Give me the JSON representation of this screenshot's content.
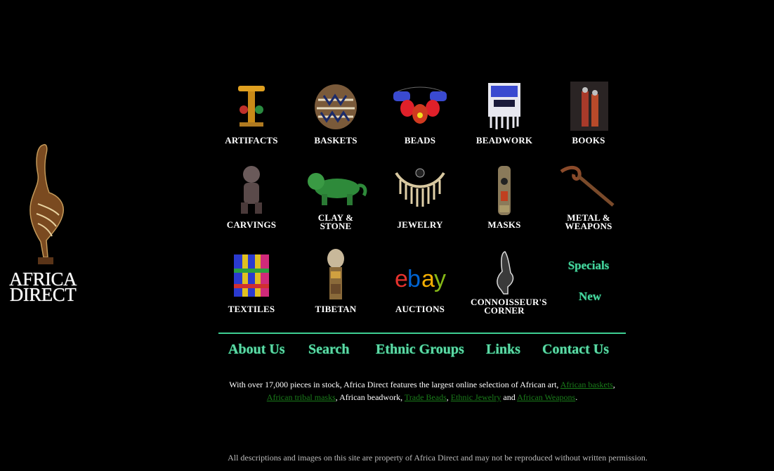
{
  "logo": {
    "line1": "AFRICA",
    "line2": "DIRECT"
  },
  "categories": [
    {
      "label1": "ARTIFACTS",
      "label2": ""
    },
    {
      "label1": "BASKETS",
      "label2": ""
    },
    {
      "label1": "BEADS",
      "label2": ""
    },
    {
      "label1": "BEADWORK",
      "label2": ""
    },
    {
      "label1": "BOOKS",
      "label2": ""
    },
    {
      "label1": "CARVINGS",
      "label2": ""
    },
    {
      "label1": "CLAY &",
      "label2": "STONE"
    },
    {
      "label1": "JEWELRY",
      "label2": ""
    },
    {
      "label1": "MASKS",
      "label2": ""
    },
    {
      "label1": "METAL &",
      "label2": "WEAPONS"
    },
    {
      "label1": "TEXTILES",
      "label2": ""
    },
    {
      "label1": "TIBETAN",
      "label2": ""
    },
    {
      "label1": "AUCTIONS",
      "label2": ""
    },
    {
      "label1": "CONNOISSEUR'S",
      "label2": "CORNER"
    }
  ],
  "specials": "Specials",
  "new": "New",
  "ebay": {
    "e": "e",
    "b": "b",
    "a": "a",
    "y": "y"
  },
  "nav": {
    "about": "About Us",
    "search": "Search",
    "ethnic": "Ethnic Groups",
    "links": "Links",
    "contact": "Contact Us"
  },
  "blurb": {
    "t1": "With over 17,000 pieces in stock, Africa Direct features the largest online selection of African art, ",
    "l1": "African baskets",
    "t2": ",",
    "l2": "African tribal masks",
    "t3": ", African beadwork, ",
    "l3": "Trade Beads",
    "t4": ", ",
    "l4": "Ethnic Jewelry",
    "t5": " and ",
    "l5": "African Weapons",
    "t6": "."
  },
  "footer": "All descriptions and images on this site are property of Africa Direct and may not be reproduced without written permission.",
  "colors": {
    "accent": "#46d6a0",
    "link": "#1a7d1a",
    "background": "#000000"
  }
}
